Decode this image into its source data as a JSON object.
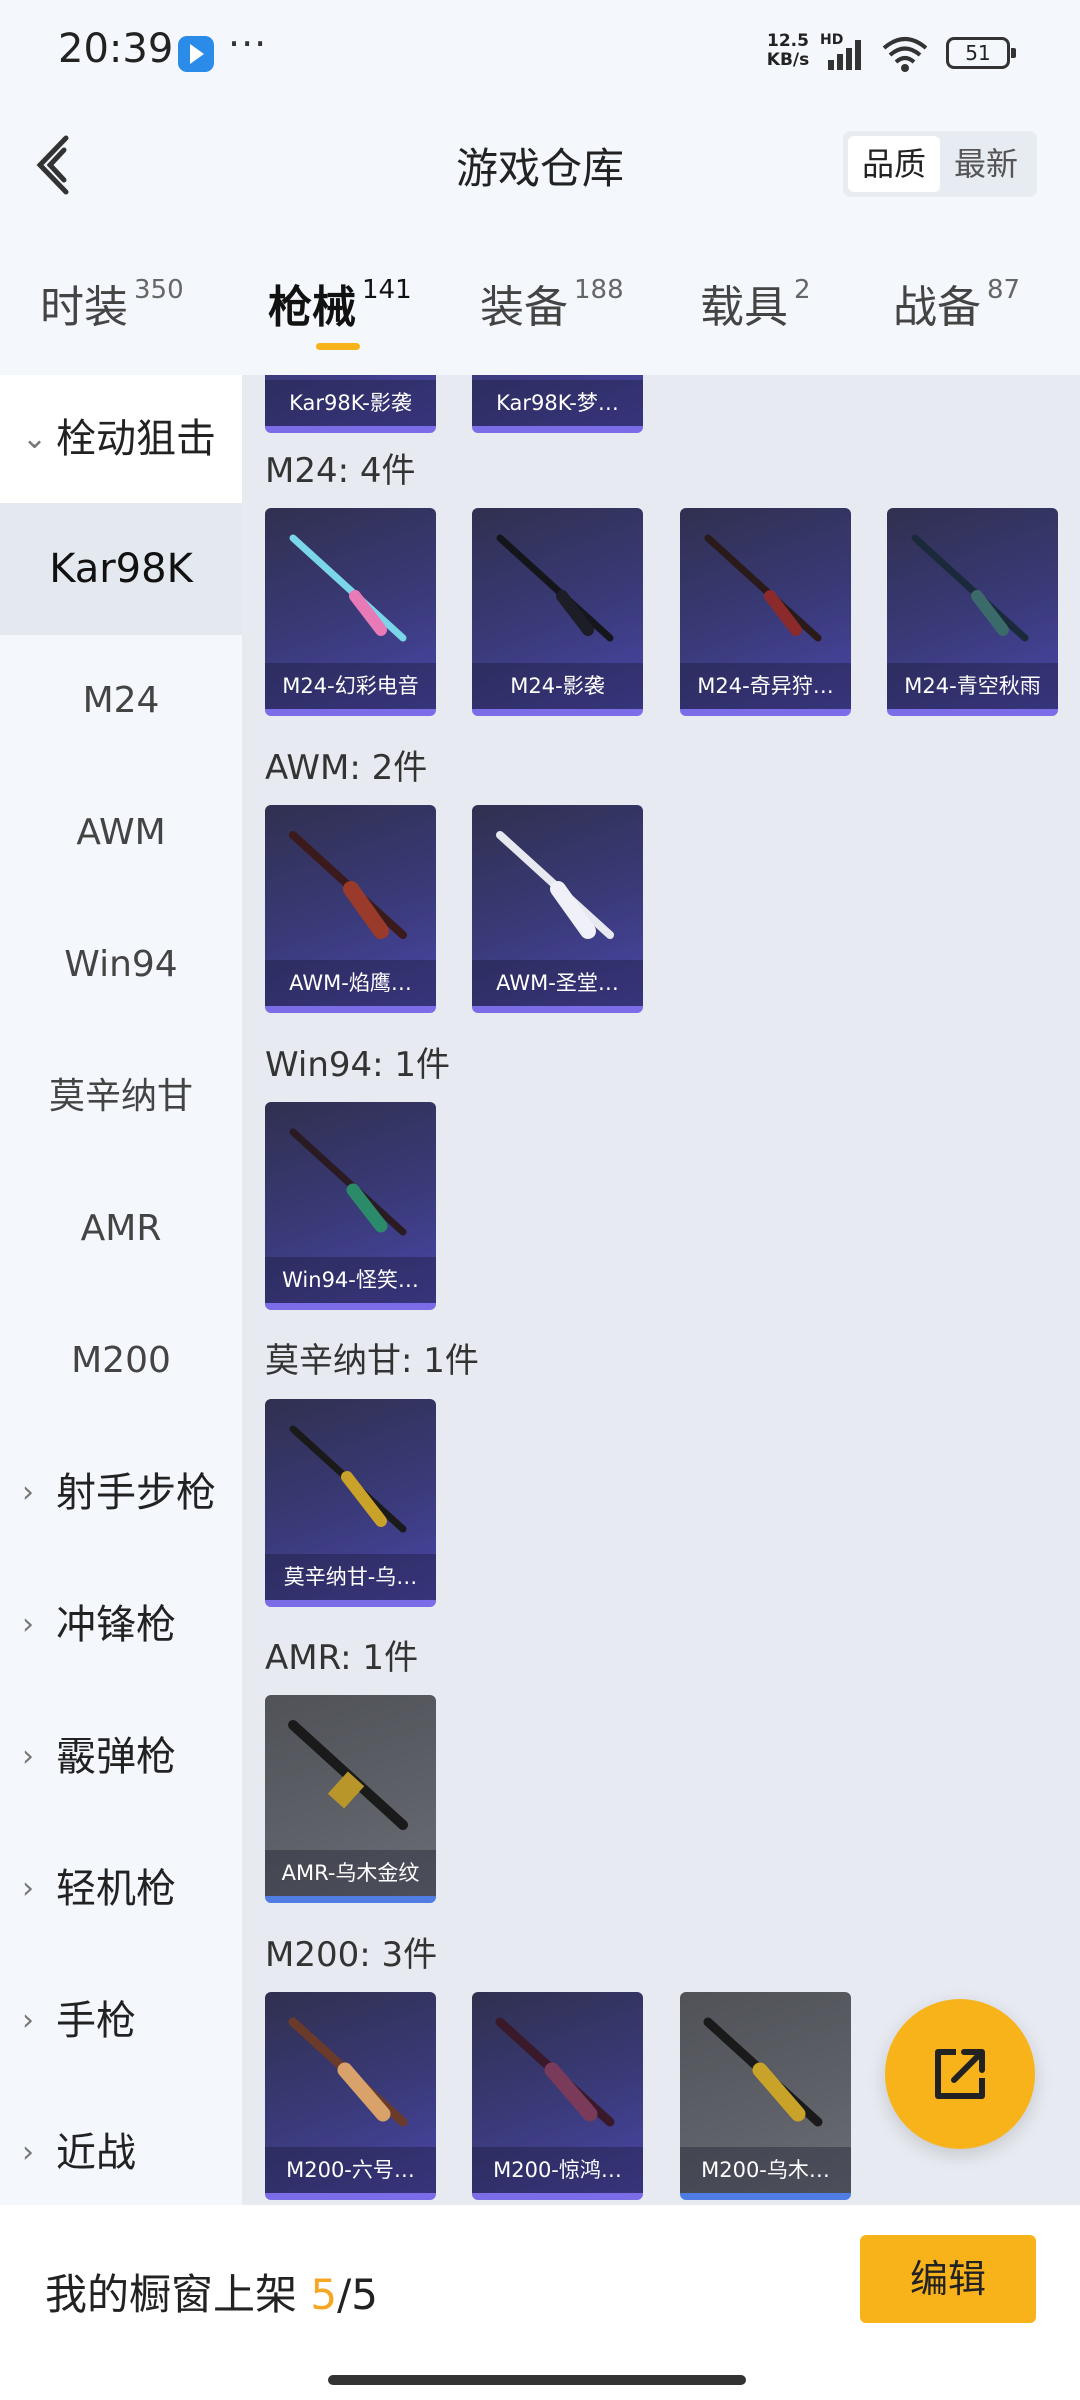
{
  "status_bar": {
    "time": "20:39",
    "dots": "···",
    "speed_value": "12.5",
    "speed_unit": "KB/s",
    "network": "HD",
    "wifi_level": "6",
    "battery": "51"
  },
  "header": {
    "title": "游戏仓库",
    "sort_options": [
      "品质",
      "最新"
    ],
    "active_sort": "品质"
  },
  "tabs": [
    {
      "label": "时装",
      "count": "350"
    },
    {
      "label": "枪械",
      "count": "141"
    },
    {
      "label": "装备",
      "count": "188"
    },
    {
      "label": "载具",
      "count": "2"
    },
    {
      "label": "战备",
      "count": "87"
    }
  ],
  "active_tab": "枪械",
  "sidebar": {
    "group_open": "栓动狙击",
    "items": [
      "Kar98K",
      "M24",
      "AWM",
      "Win94",
      "莫辛纳甘",
      "AMR",
      "M200"
    ],
    "active_item": "Kar98K",
    "groups_closed": [
      "射手步枪",
      "冲锋枪",
      "霰弹枪",
      "轻机枪",
      "手枪",
      "近战"
    ]
  },
  "content": {
    "top_partial_cards": [
      "Kar98K-影袭",
      "Kar98K-梦…"
    ],
    "sections": [
      {
        "title": "M24: 4件",
        "cards": [
          "M24-幻彩电音",
          "M24-影袭",
          "M24-奇异狩…",
          "M24-青空秋雨"
        ]
      },
      {
        "title": "AWM: 2件",
        "cards": [
          "AWM-焰鹰…",
          "AWM-圣堂…"
        ]
      },
      {
        "title": "Win94: 1件",
        "cards": [
          "Win94-怪笑…"
        ]
      },
      {
        "title": "莫辛纳甘: 1件",
        "cards": [
          "莫辛纳甘-乌…"
        ]
      },
      {
        "title": "AMR: 1件",
        "cards": [
          "AMR-乌木金纹"
        ]
      },
      {
        "title": "M200: 3件",
        "cards": [
          "M200-六号…",
          "M200-惊鸿…",
          "M200-乌木…"
        ]
      }
    ]
  },
  "bottom_bar": {
    "label": "我的橱窗上架",
    "current": "5",
    "separator": "/",
    "total": "5",
    "edit_label": "编辑"
  },
  "colors": {
    "accent": "#f9b31a",
    "background": "#f4f7fc",
    "content_bg": "#e7ebf1",
    "card_purple": "#3a3a7a",
    "card_gray": "#5e6168"
  }
}
